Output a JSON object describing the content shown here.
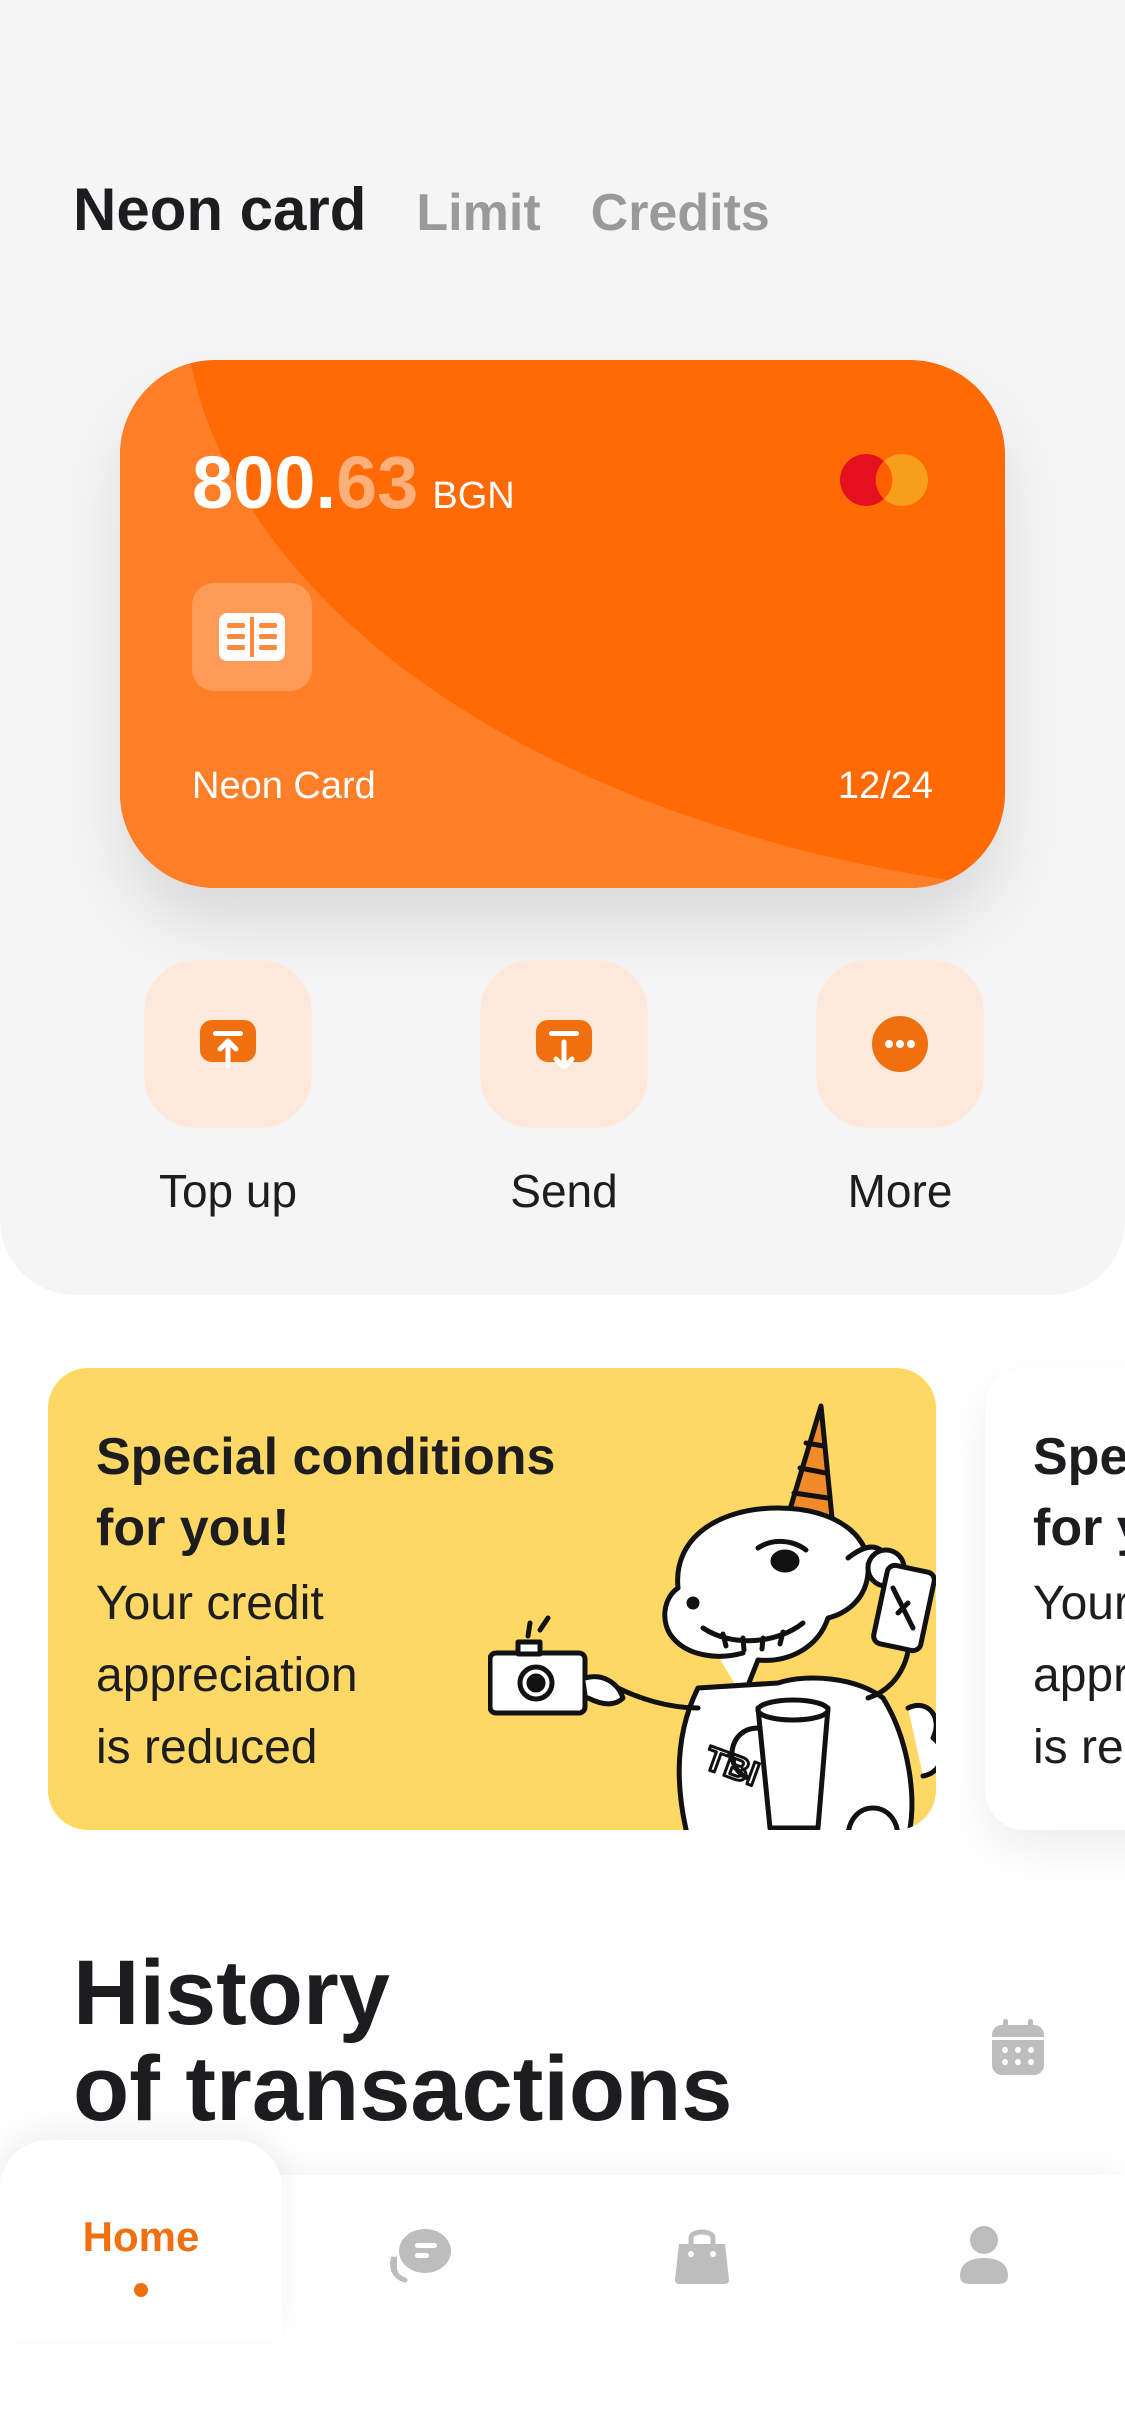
{
  "tabs": {
    "active": "Neon card",
    "items": [
      "Limit",
      "Credits"
    ]
  },
  "card": {
    "balance_int": "800.",
    "balance_frac": "63",
    "currency": "BGN",
    "name": "Neon Card",
    "expiry": "12/24",
    "brand_icon": "mastercard-icon",
    "color": "#ff6a05"
  },
  "actions": [
    {
      "label": "Top up",
      "icon": "top-up-icon"
    },
    {
      "label": "Send",
      "icon": "send-icon"
    },
    {
      "label": "More",
      "icon": "more-icon"
    }
  ],
  "promos": [
    {
      "title": "Special conditions\nfor you!",
      "body": "Your credit\nappreciation\nis reduced",
      "color": "#fdd864"
    },
    {
      "title": "Spe\nfor y",
      "body": "Your\nappr\nis red"
    }
  ],
  "history": {
    "title": "History\nof transactions",
    "icon": "calendar-icon"
  },
  "nav": {
    "home_label": "Home",
    "accent": "#f0700f",
    "items": [
      "chat-icon",
      "shop-bag-icon",
      "profile-icon"
    ]
  }
}
